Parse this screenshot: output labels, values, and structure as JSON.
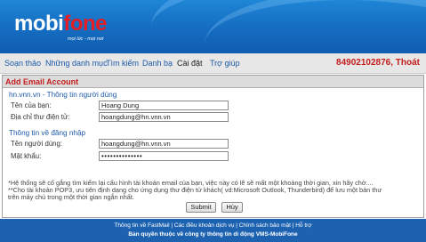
{
  "header": {
    "logo_mobi": "mobi",
    "logo_fone": "fone",
    "slogan": "mọi lúc - mọi nơi"
  },
  "nav": {
    "items": [
      "Soạn thảo",
      "Những danh mục",
      "Tìm kiếm",
      "Danh bạ",
      "Cài đặt",
      "Trợ giúp"
    ],
    "active": "Cài đặt",
    "phone": "84902102876",
    "sep": ",",
    "logout": "Thoát"
  },
  "panel": {
    "title": "Add Email Account",
    "section_user": "hn.vnn.vn - Thông tin người dùng",
    "label_name": "Tên của bạn:",
    "value_name": "Hoang Dung",
    "label_email": "Địa chỉ thư điện tử:",
    "value_email": "hoangdung@hn.vnn.vn",
    "section_login": "Thông tin về đăng nhập",
    "label_username": "Tên người dùng:",
    "value_username": "hoangdung@hn.vnn.vn",
    "label_password": "Mật khẩu:",
    "value_password": "••••••••••••••",
    "submit": "Submit",
    "cancel": "Hủy",
    "note1": "*Hệ thống sẽ cố gắng tìm kiếm lại cấu hình tài khoản email của bạn, việc này có lẽ sẽ mất một khoảng thời gian, xin hãy chờ....",
    "note2": "**Cho tài khoản POP3, ưu tiên định dạng cho ứng dụng thư điện tử khách( vd:Microsoft Outlook, Thunderbird) để lưu một bản thư",
    "note3": "trên máy chủ trong một thời gian ngắn nhất."
  },
  "footer": {
    "links": "Thông tin về FastMail | Các điều khoản dịch vụ | Chính sách bảo mật | Hỗ trợ",
    "copyright": "Bản quyền thuộc về công ty thông tin di động VMS-MobiFone"
  }
}
